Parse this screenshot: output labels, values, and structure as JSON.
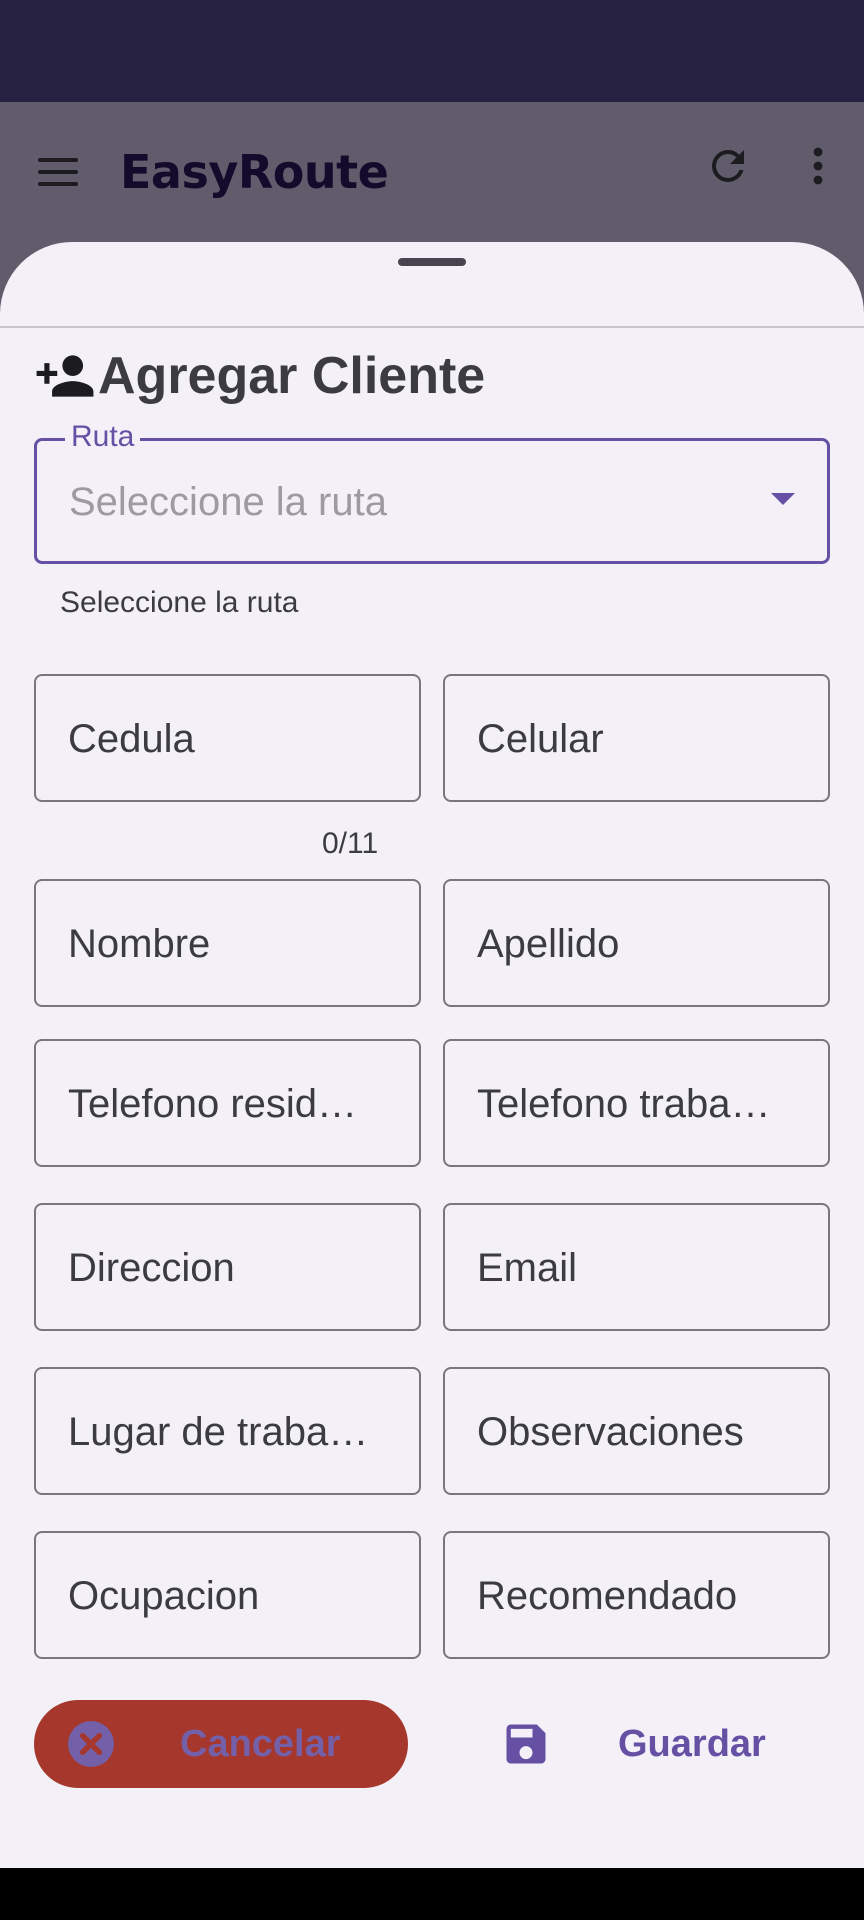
{
  "app": {
    "title": "EasyRoute"
  },
  "sheet": {
    "title": "Agregar Cliente",
    "route": {
      "label": "Ruta",
      "placeholder": "Seleccione la ruta",
      "helper": "Seleccione la ruta"
    },
    "fields": {
      "cedula": "Cedula",
      "cedula_counter": "0/11",
      "celular": "Celular",
      "nombre": "Nombre",
      "apellido": "Apellido",
      "telefono_residencial": "Telefono resid…",
      "telefono_trabajo": "Telefono traba…",
      "direccion": "Direccion",
      "email": "Email",
      "lugar_trabajo": "Lugar de traba…",
      "observaciones": "Observaciones",
      "ocupacion": "Ocupacion",
      "recomendado": "Recomendado"
    },
    "actions": {
      "cancel": "Cancelar",
      "save": "Guardar"
    }
  },
  "icons": {
    "menu": "menu-icon",
    "refresh": "refresh-icon",
    "overflow": "more-vert-icon",
    "add_person": "person-add-icon",
    "dropdown": "arrow-drop-down-icon",
    "cancel": "cancel-icon",
    "save": "save-icon"
  },
  "colors": {
    "status_bar": "#272141",
    "scrim": "#605c6c",
    "sheet_bg": "#f3f0f8",
    "primary": "#6550a4",
    "cancel_bg": "#a5372c"
  }
}
